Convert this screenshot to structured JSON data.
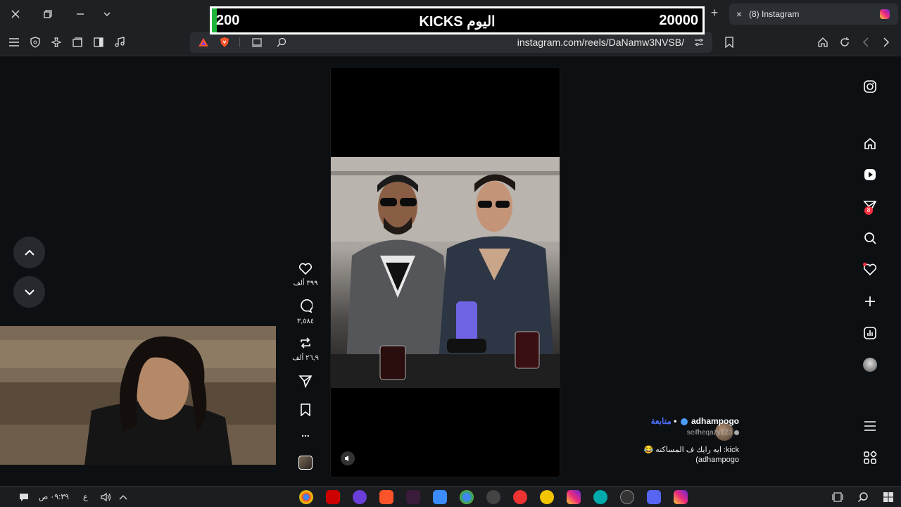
{
  "kicks_bar": {
    "left_value": "200",
    "center_label": "KICKS اليوم",
    "right_value": "20000",
    "progress_fraction": 0.01,
    "fill_color": "#1eb53a"
  },
  "tab": {
    "title": "(8) Instagram",
    "close_icon": "×"
  },
  "address_bar": {
    "url": "instagram.com/reels/DaNamw3NVSB/"
  },
  "reel": {
    "likes": "٣٩٩ ألف",
    "comments": "٣,٥٨٤",
    "reposts": "٢٦,٩ ألف",
    "more": "...",
    "author": "adhampogo",
    "follow_label": "متابعة",
    "separator": "•",
    "subuser": "seifheqazy123",
    "caption": "kick:  ايه رايك ف المساكته 😂 adhampogo)"
  },
  "right_nav": {
    "messages_badge": "8"
  },
  "taskbar": {
    "time": "٠٩:٣٩ ص",
    "lang": "ع"
  },
  "colors": {
    "accent_follow": "#4c6ef5",
    "notification": "#ff3040",
    "brave_orange": "#fb542b"
  }
}
